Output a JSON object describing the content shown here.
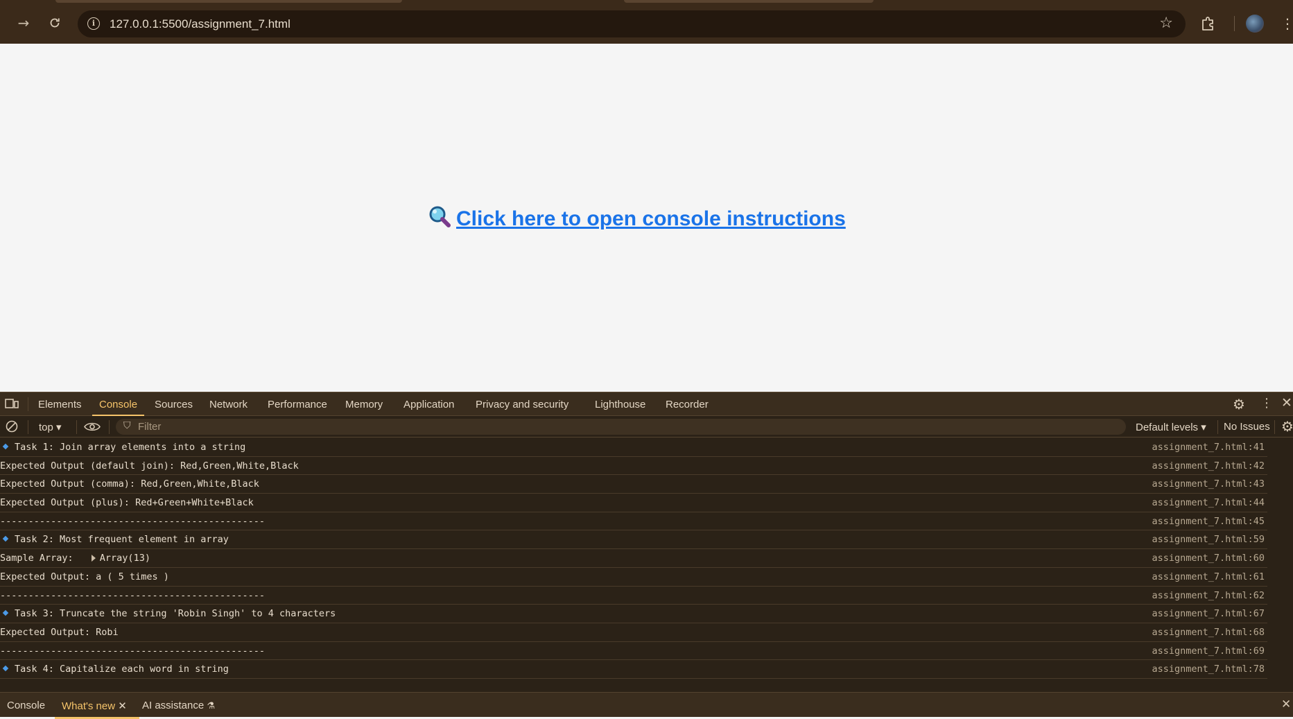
{
  "browser": {
    "url": "127.0.0.1:5500/assignment_7.html",
    "icons": [
      "forward-icon",
      "reload-icon",
      "site-info-icon",
      "bookmark-star-icon",
      "extensions-icon",
      "profile-avatar",
      "browser-menu-icon"
    ]
  },
  "page": {
    "link_text": "Click here to open console instructions",
    "link_color": "#1a73e8"
  },
  "devtools": {
    "tabs": [
      "Elements",
      "Console",
      "Sources",
      "Network",
      "Performance",
      "Memory",
      "Application",
      "Privacy and security",
      "Lighthouse",
      "Recorder"
    ],
    "active_tab": "Console",
    "context_selector": "top",
    "filter_placeholder": "Filter",
    "levels": "Default levels",
    "issues": "No Issues",
    "accent_color": "#f6c46a",
    "logs": [
      {
        "text": "Task 1: Join array elements into a string",
        "source": "assignment_7.html:41",
        "marker": "diamond"
      },
      {
        "text": "Expected Output (default join): Red,Green,White,Black",
        "source": "assignment_7.html:42",
        "marker": "none"
      },
      {
        "text": "Expected Output (comma): Red,Green,White,Black",
        "source": "assignment_7.html:43",
        "marker": "none"
      },
      {
        "text": "Expected Output (plus): Red+Green+White+Black",
        "source": "assignment_7.html:44",
        "marker": "none"
      },
      {
        "text": "-----------------------------------------------",
        "source": "assignment_7.html:45",
        "marker": "none"
      },
      {
        "text": "Task 2: Most frequent element in array",
        "source": "assignment_7.html:59",
        "marker": "diamond"
      },
      {
        "text": "Sample Array: ",
        "object": "Array(13)",
        "source": "assignment_7.html:60",
        "marker": "none"
      },
      {
        "text": "Expected Output: a ( 5 times )",
        "source": "assignment_7.html:61",
        "marker": "none"
      },
      {
        "text": "-----------------------------------------------",
        "source": "assignment_7.html:62",
        "marker": "none"
      },
      {
        "text": "Task 3: Truncate the string 'Robin Singh' to 4 characters",
        "source": "assignment_7.html:67",
        "marker": "diamond"
      },
      {
        "text": "Expected Output: Robi",
        "source": "assignment_7.html:68",
        "marker": "none"
      },
      {
        "text": "-----------------------------------------------",
        "source": "assignment_7.html:69",
        "marker": "none"
      },
      {
        "text": "Task 4: Capitalize each word in string",
        "source": "assignment_7.html:78",
        "marker": "diamond"
      }
    ],
    "drawer_tabs": [
      "Console",
      "What's new",
      "AI assistance"
    ],
    "drawer_active": "What's new"
  }
}
